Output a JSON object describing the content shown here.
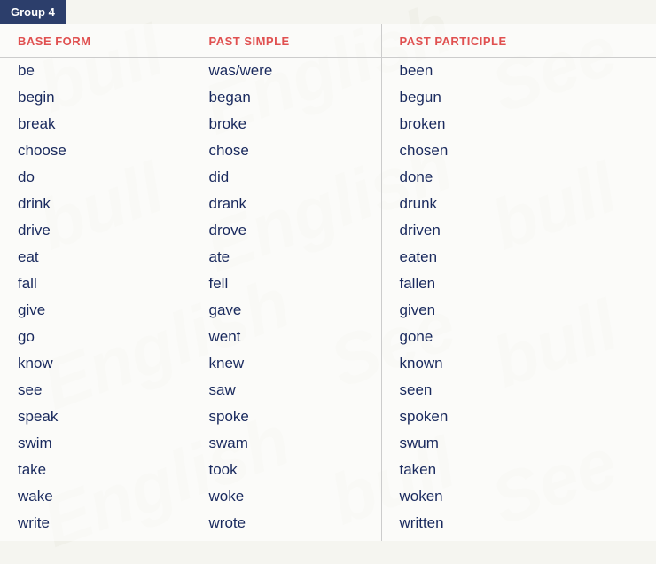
{
  "header": {
    "group_label": "Group 4"
  },
  "columns": {
    "col1": "BASE FORM",
    "col2": "PAST SIMPLE",
    "col3": "PAST PARTICIPLE"
  },
  "rows": [
    {
      "base": "be",
      "past_simple": "was/were",
      "past_participle": "been"
    },
    {
      "base": "begin",
      "past_simple": "began",
      "past_participle": "begun"
    },
    {
      "base": "break",
      "past_simple": "broke",
      "past_participle": "broken"
    },
    {
      "base": "choose",
      "past_simple": "chose",
      "past_participle": "chosen"
    },
    {
      "base": "do",
      "past_simple": "did",
      "past_participle": "done"
    },
    {
      "base": "drink",
      "past_simple": "drank",
      "past_participle": "drunk"
    },
    {
      "base": "drive",
      "past_simple": "drove",
      "past_participle": "driven"
    },
    {
      "base": "eat",
      "past_simple": "ate",
      "past_participle": "eaten"
    },
    {
      "base": "fall",
      "past_simple": "fell",
      "past_participle": "fallen"
    },
    {
      "base": "give",
      "past_simple": "gave",
      "past_participle": "given"
    },
    {
      "base": "go",
      "past_simple": "went",
      "past_participle": "gone"
    },
    {
      "base": "know",
      "past_simple": "knew",
      "past_participle": "known"
    },
    {
      "base": "see",
      "past_simple": "saw",
      "past_participle": "seen"
    },
    {
      "base": "speak",
      "past_simple": "spoke",
      "past_participle": "spoken"
    },
    {
      "base": "swim",
      "past_simple": "swam",
      "past_participle": "swum"
    },
    {
      "base": "take",
      "past_simple": "took",
      "past_participle": "taken"
    },
    {
      "base": "wake",
      "past_simple": "woke",
      "past_participle": "woken"
    },
    {
      "base": "write",
      "past_simple": "wrote",
      "past_participle": "written"
    }
  ],
  "watermark_words": [
    "bull",
    "English",
    "See"
  ]
}
